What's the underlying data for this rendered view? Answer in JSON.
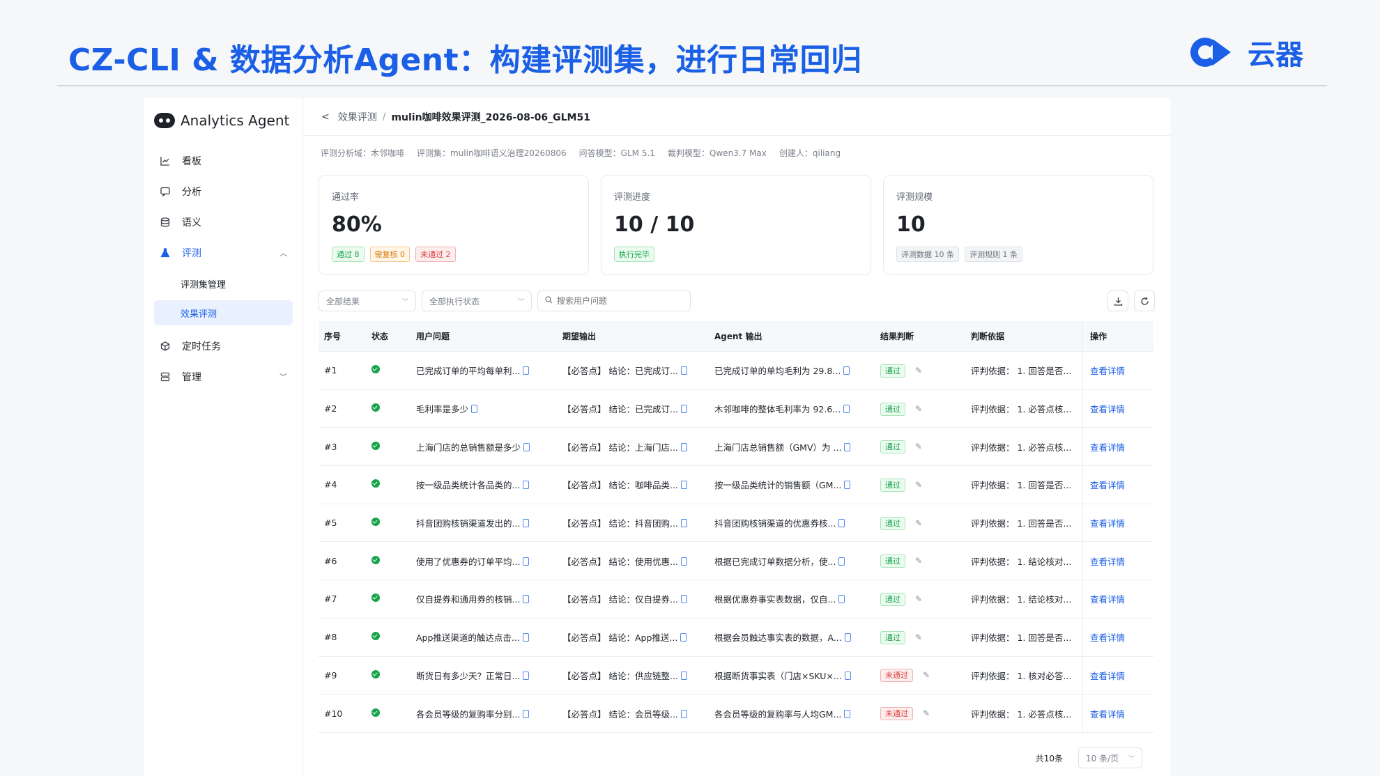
{
  "slide": {
    "title": "CZ-CLI & 数据分析Agent：构建评测集，进行日常回归",
    "brand": "云器"
  },
  "sidebar": {
    "app_name": "Analytics Agent",
    "items": [
      {
        "label": "看板",
        "icon": "chart-icon"
      },
      {
        "label": "分析",
        "icon": "chat-icon"
      },
      {
        "label": "语义",
        "icon": "database-icon"
      },
      {
        "label": "评测",
        "icon": "flask-icon"
      },
      {
        "label": "定时任务",
        "icon": "cube-icon"
      },
      {
        "label": "管理",
        "icon": "server-icon"
      }
    ],
    "sub_items": [
      "评测集管理",
      "效果评测"
    ]
  },
  "breadcrumb": {
    "parent": "效果评测",
    "current": "mulin咖啡效果评测_2026-08-06_GLM51"
  },
  "meta": [
    "评测分析域：木邻咖啡",
    "评测集：mulin咖啡语义治理20260806",
    "问答模型：GLM 5.1",
    "裁判模型：Qwen3.7 Max",
    "创建人：qiliang"
  ],
  "cards": {
    "pass_rate": {
      "label": "通过率",
      "value": "80%",
      "tags": [
        "通过 8",
        "需复核 0",
        "未通过 2"
      ]
    },
    "progress": {
      "label": "评测进度",
      "value": "10 / 10",
      "tag": "执行完毕"
    },
    "scale": {
      "label": "评测规模",
      "value": "10",
      "tags": [
        "评测数据 10 条",
        "评测规则 1 条"
      ]
    }
  },
  "filters": {
    "result": "全部结果",
    "exec_status": "全部执行状态",
    "search_placeholder": "搜索用户问题"
  },
  "table": {
    "headers": [
      "序号",
      "状态",
      "用户问题",
      "期望输出",
      "Agent 输出",
      "结果判断",
      "判断依据",
      "操作"
    ],
    "rows": [
      {
        "no": "#1",
        "q": "已完成订单的平均每单利...",
        "exp": "【必答点】 结论：已完成订...",
        "ag": "已完成订单的单均毛利为 29.8...",
        "judge": "通过",
        "reason": "评判依据： 1. 回答是否...",
        "op": "查看详情"
      },
      {
        "no": "#2",
        "q": "毛利率是多少",
        "exp": "【必答点】 结论：已完成订...",
        "ag": "木邻咖啡的整体毛利率为 92.6...",
        "judge": "通过",
        "reason": "评判依据： 1. 必答点核...",
        "op": "查看详情"
      },
      {
        "no": "#3",
        "q": "上海门店的总销售额是多少",
        "exp": "【必答点】 结论：上海门店...",
        "ag": "上海门店总销售额（GMV）为 ...",
        "judge": "通过",
        "reason": "评判依据： 1. 必答点核...",
        "op": "查看详情"
      },
      {
        "no": "#4",
        "q": "按一级品类统计各品类的...",
        "exp": "【必答点】 结论：咖啡品类...",
        "ag": "按一级品类统计的销售额（GM...",
        "judge": "通过",
        "reason": "评判依据： 1. 回答是否...",
        "op": "查看详情"
      },
      {
        "no": "#5",
        "q": "抖音团购核销渠道发出的...",
        "exp": "【必答点】 结论：抖音团购...",
        "ag": "抖音团购核销渠道的优惠券核...",
        "judge": "通过",
        "reason": "评判依据： 1. 回答是否...",
        "op": "查看详情"
      },
      {
        "no": "#6",
        "q": "使用了优惠券的订单平均...",
        "exp": "【必答点】 结论：使用优惠...",
        "ag": "根据已完成订单数据分析，使...",
        "judge": "通过",
        "reason": "评判依据： 1. 结论核对...",
        "op": "查看详情"
      },
      {
        "no": "#7",
        "q": "仅自提券和通用券的核销...",
        "exp": "【必答点】 结论：仅自提券...",
        "ag": "根据优惠券事实表数据，仅自...",
        "judge": "通过",
        "reason": "评判依据： 1. 结论核对...",
        "op": "查看详情"
      },
      {
        "no": "#8",
        "q": "App推送渠道的触达点击...",
        "exp": "【必答点】 结论：App推送...",
        "ag": "根据会员触达事实表的数据，A...",
        "judge": "通过",
        "reason": "评判依据： 1. 回答是否...",
        "op": "查看详情"
      },
      {
        "no": "#9",
        "q": "断货日有多少天？正常日...",
        "exp": "【必答点】 结论：供应链整...",
        "ag": "根据断货事实表（门店×SKU×...",
        "judge": "未通过",
        "reason": "评判依据： 1. 核对必答...",
        "op": "查看详情"
      },
      {
        "no": "#10",
        "q": "各会员等级的复购率分别...",
        "exp": "【必答点】 结论：会员等级...",
        "ag": "各会员等级的复购率与人均GM...",
        "judge": "未通过",
        "reason": "评判依据： 1. 必答点核...",
        "op": "查看详情"
      }
    ]
  },
  "pager": {
    "total": "共10条",
    "page_size": "10 条/页"
  },
  "colors": {
    "accent": "#1a5fe6",
    "pass": "#16a34a",
    "fail": "#dc3a3a",
    "review": "#d97706"
  }
}
